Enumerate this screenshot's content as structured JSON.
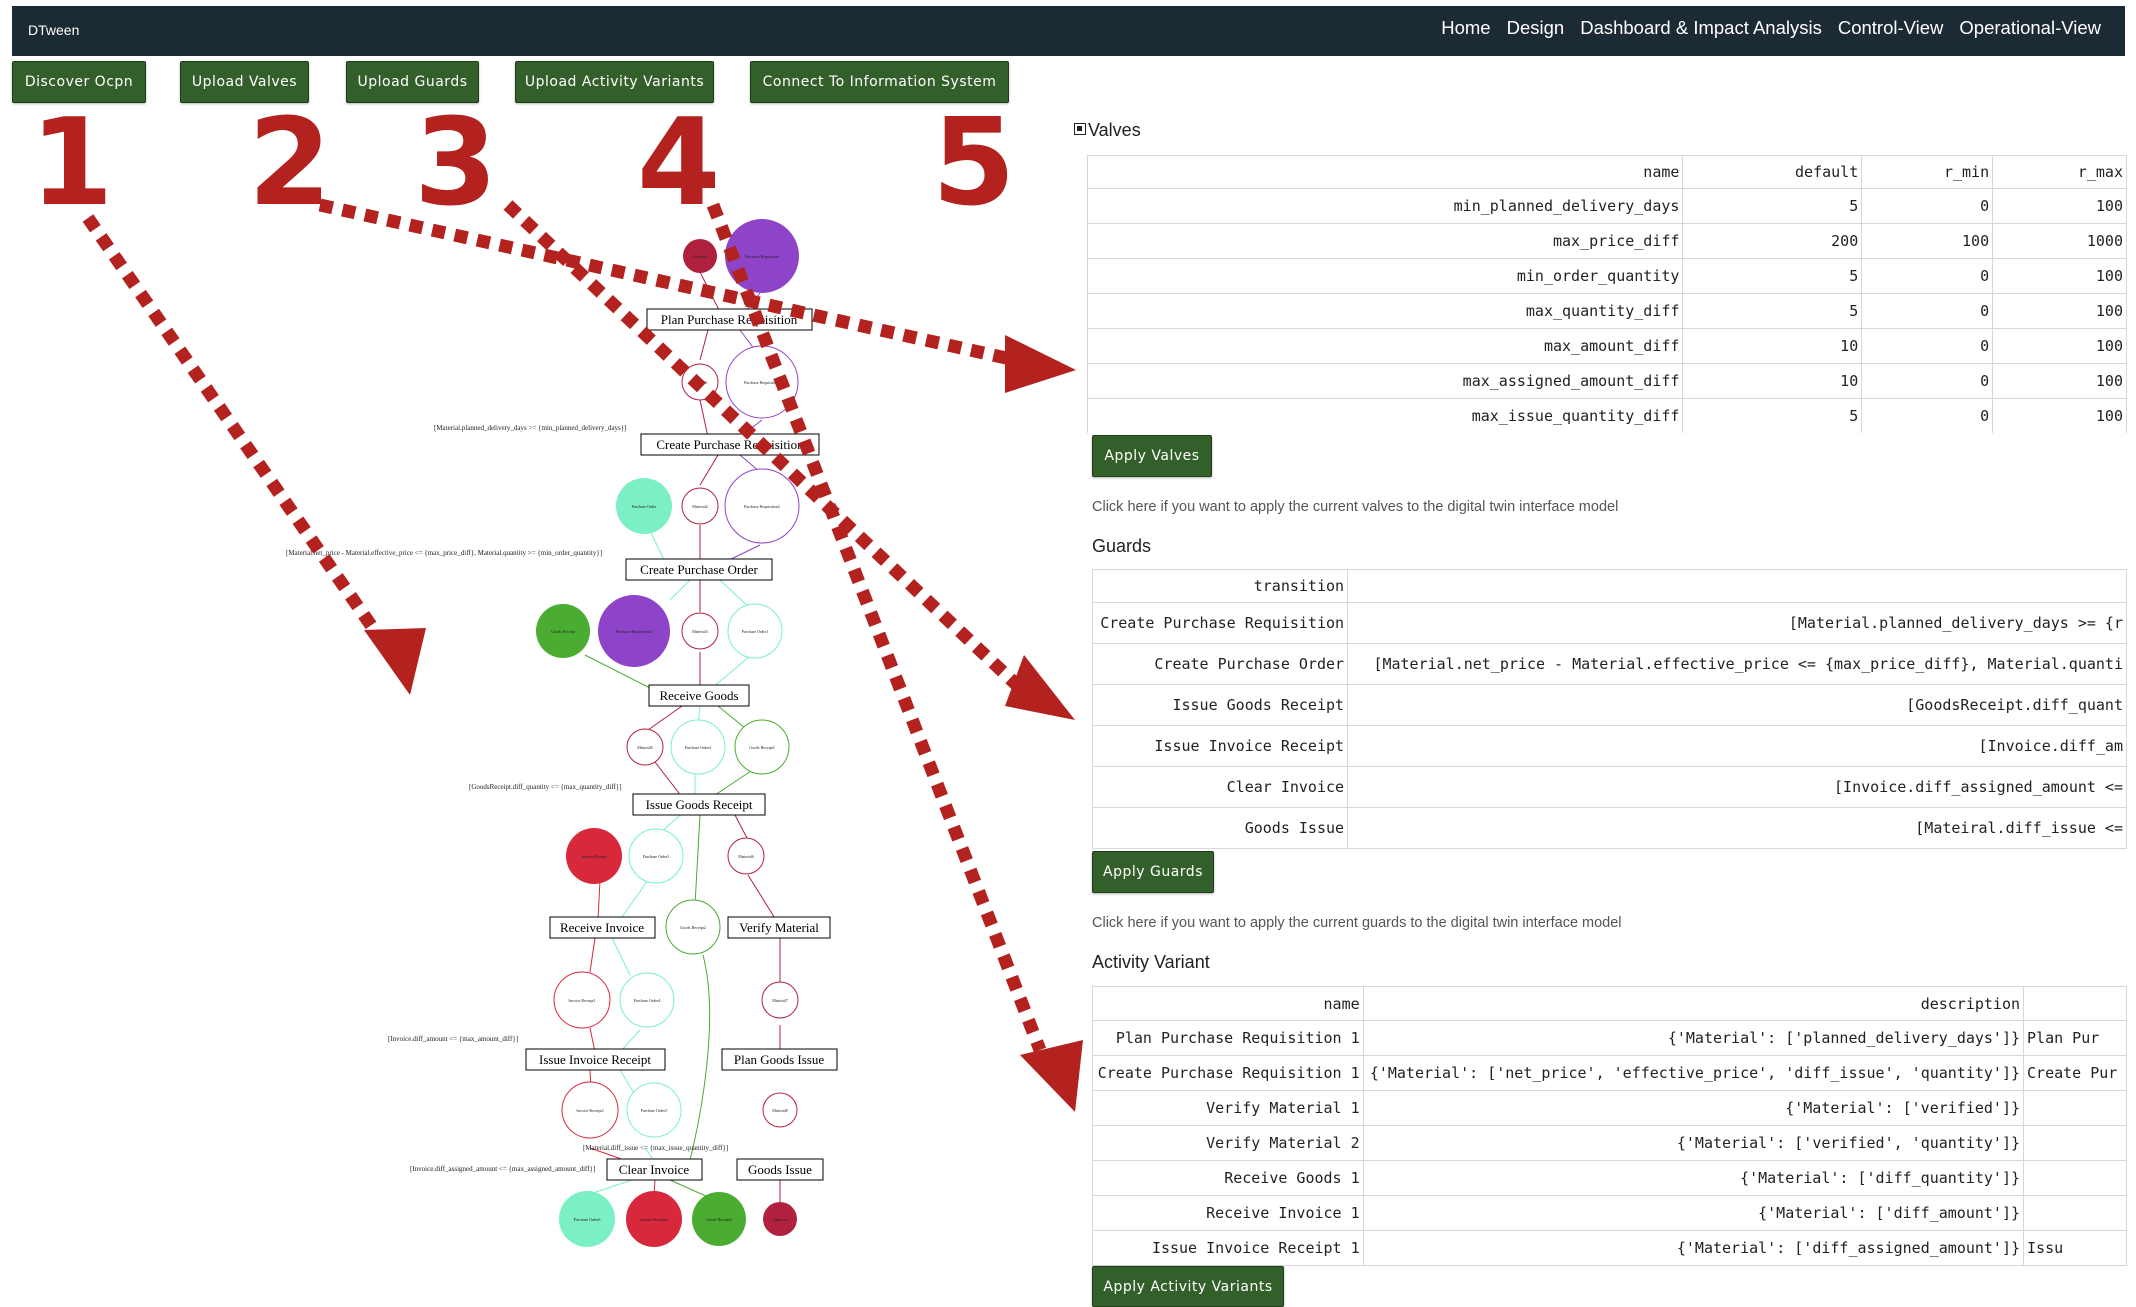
{
  "navbar": {
    "brand": "DTween",
    "links": [
      "Home",
      "Design",
      "Dashboard & Impact Analysis",
      "Control-View",
      "Operational-View"
    ]
  },
  "toolbar": {
    "discover": "Discover Ocpn",
    "upload_valves": "Upload Valves",
    "upload_guards": "Upload Guards",
    "upload_variants": "Upload Activity Variants",
    "connect": "Connect To Information System"
  },
  "step_numbers": [
    "1",
    "2",
    "3",
    "4",
    "5"
  ],
  "valves": {
    "title": "Valves",
    "headers": [
      "name",
      "default",
      "r_min",
      "r_max"
    ],
    "rows": [
      [
        "min_planned_delivery_days",
        "5",
        "0",
        "100"
      ],
      [
        "max_price_diff",
        "200",
        "100",
        "1000"
      ],
      [
        "min_order_quantity",
        "5",
        "0",
        "100"
      ],
      [
        "max_quantity_diff",
        "5",
        "0",
        "100"
      ],
      [
        "max_amount_diff",
        "10",
        "0",
        "100"
      ],
      [
        "max_assigned_amount_diff",
        "10",
        "0",
        "100"
      ],
      [
        "max_issue_quantity_diff",
        "5",
        "0",
        "100"
      ]
    ],
    "apply": "Apply Valves",
    "help": "Click here if you want to apply the current valves to the digital twin interface model"
  },
  "guards": {
    "title": "Guards",
    "headers": [
      "transition",
      ""
    ],
    "rows": [
      [
        "Create Purchase Requisition",
        "[Material.planned_delivery_days >= {r"
      ],
      [
        "Create Purchase Order",
        "[Material.net_price - Material.effective_price <= {max_price_diff}, Material.quanti"
      ],
      [
        "Issue Goods Receipt",
        "[GoodsReceipt.diff_quant"
      ],
      [
        "Issue Invoice Receipt",
        "[Invoice.diff_am"
      ],
      [
        "Clear Invoice",
        "[Invoice.diff_assigned_amount <= "
      ],
      [
        "Goods Issue",
        "[Mateiral.diff_issue <="
      ]
    ],
    "apply": "Apply Guards",
    "help": "Click here if you want to apply the current guards to the digital twin interface model"
  },
  "variants": {
    "title": "Activity Variant",
    "headers": [
      "name",
      "description",
      ""
    ],
    "rows": [
      [
        "Plan Purchase Requisition 1",
        "{'Material': ['planned_delivery_days']}",
        "Plan Pur"
      ],
      [
        "Create Purchase Requisition 1",
        "{'Material': ['net_price', 'effective_price', 'diff_issue', 'quantity']}",
        "Create Pur"
      ],
      [
        "Verify Material 1",
        "{'Material': ['verified']}",
        ""
      ],
      [
        "Verify Material 2",
        "{'Material': ['verified', 'quantity']}",
        ""
      ],
      [
        "Receive Goods 1",
        "{'Material': ['diff_quantity']}",
        ""
      ],
      [
        "Receive Invoice 1",
        "{'Material': ['diff_amount']}",
        ""
      ],
      [
        "Issue Invoice Receipt 1",
        "{'Material': ['diff_assigned_amount']}",
        "Issu"
      ]
    ],
    "apply": "Apply Activity Variants"
  },
  "ocpn": {
    "transitions": {
      "plan_pr": "Plan Purchase Requisition",
      "create_pr": "Create Purchase Requisition",
      "create_po": "Create Purchase Order",
      "receive_goods": "Receive Goods",
      "issue_gr": "Issue Goods Receipt",
      "receive_invoice": "Receive Invoice",
      "verify_material": "Verify Material",
      "issue_ir": "Issue Invoice Receipt",
      "plan_gi": "Plan Goods Issue",
      "clear_invoice": "Clear Invoice",
      "goods_issue": "Goods Issue"
    },
    "guards": {
      "g1": "[Material.planned_delivery_days >= {min_planned_delivery_days}]",
      "g2": "[Material.net_price - Material.effective_price <= {max_price_diff}, Material.quantity >= {min_order_quantity}]",
      "g3": "[GoodsReceipt.diff_quantity <= {max_quantity_diff}]",
      "g4": "[Invoice.diff_amount <= {max_amount_diff}]",
      "g5": "[Material.diff_issue <= {max_issue_quantity_diff}]",
      "g6": "[Invoice.diff_assigned_amount <= {max_assigned_amount_diff}]"
    },
    "places": {
      "material": "Material",
      "material1": "Material1",
      "material2": "Material2",
      "material3": "Material3",
      "material5": "Material5",
      "material6": "Material6",
      "material7": "Material7",
      "material8": "Material8",
      "pr": "Purchase Requisition",
      "pr1": "Purchase Requisition1",
      "pr2": "Purchase Requisition2",
      "pr3": "Purchase Requisition3",
      "po": "Purchase Order",
      "po1": "Purchase Order1",
      "po2": "Purchase Order2",
      "po3": "Purchase Order3",
      "po4": "Purchase Order4",
      "po5": "Purchase Order5",
      "po6": "Purchase Order6",
      "gr": "Goods Receipt",
      "gr1": "Goods Receipt1",
      "gr2": "Goods Receipt2",
      "gr3": "Goods Receipt3",
      "ir": "Invoice Receipt",
      "ir1": "Invoice Receipt1",
      "ir2": "Invoice Receipt2",
      "ir3": "Invoice Receipt3"
    }
  },
  "colors": {
    "nav_bg": "#1c2a33",
    "button_green": "#33602a",
    "arrow_red": "#b3221e",
    "material": "#b0213f",
    "purchase_requisition": "#8e44c9",
    "purchase_order": "#7bf0c4",
    "goods_receipt": "#4aac31",
    "invoice_receipt": "#d8283c"
  }
}
